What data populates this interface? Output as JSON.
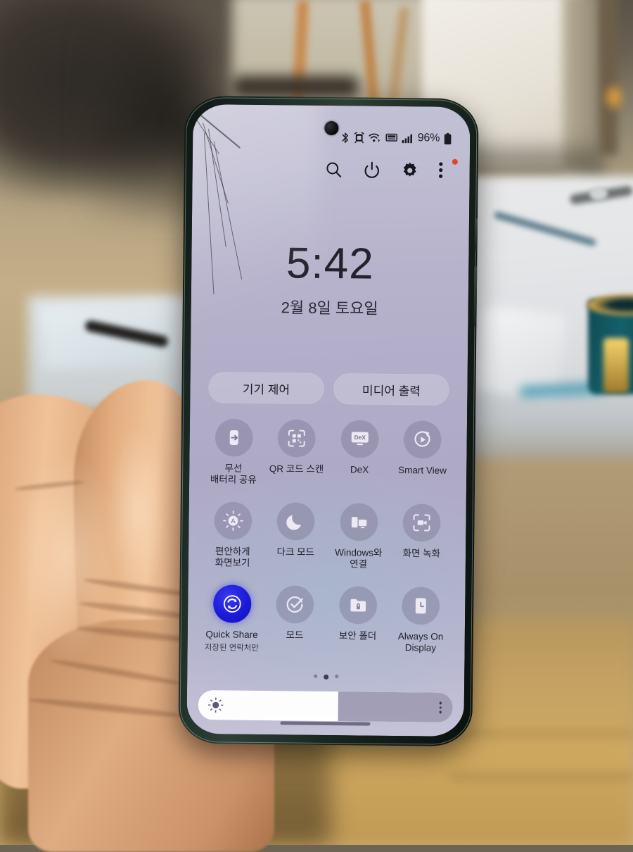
{
  "device": {
    "type": "smartphone",
    "orientation": "portrait",
    "screen_panel": "quick-settings",
    "note_visible_damage": "cracked glass top-left corner"
  },
  "colors": {
    "panel_bg": "#b2aec9",
    "accent_active": "#1a1ad8",
    "badge_red": "#e8402a",
    "text_primary": "#201f2a",
    "slider_track": "#8b86a4"
  },
  "statusbar": {
    "icons": [
      {
        "name": "bluetooth-icon",
        "label": "Bluetooth"
      },
      {
        "name": "alarm-icon",
        "label": "Alarm"
      },
      {
        "name": "wifi-calling-icon",
        "label": "Wi-Fi calling"
      },
      {
        "name": "volte-icon",
        "label": "VoLTE"
      },
      {
        "name": "signal-icon",
        "label": "Mobile signal"
      }
    ],
    "battery_percent": "96%",
    "battery_icon": "battery-full-icon"
  },
  "quick_settings_header": {
    "buttons": [
      {
        "name": "search-icon",
        "label": "Search"
      },
      {
        "name": "power-icon",
        "label": "Power"
      },
      {
        "name": "settings-gear-icon",
        "label": "Settings"
      },
      {
        "name": "overflow-menu-icon",
        "label": "More options",
        "badge": true
      }
    ]
  },
  "clock": {
    "time": "5:42",
    "date": "2월 8일 토요일"
  },
  "pills": [
    {
      "name": "device-control-pill",
      "label": "기기 제어"
    },
    {
      "name": "media-output-pill",
      "label": "미디어 출력"
    }
  ],
  "tiles": {
    "rows": [
      [
        {
          "name": "tile-wireless-power-share",
          "label": "무선\n배터리 공유",
          "icon": "battery-share-icon",
          "active": false
        },
        {
          "name": "tile-qr-scanner",
          "label": "QR 코드 스캔",
          "icon": "qr-scan-icon",
          "active": false
        },
        {
          "name": "tile-dex",
          "label": "DeX",
          "icon": "dex-icon",
          "active": false
        },
        {
          "name": "tile-smart-view",
          "label": "Smart View",
          "icon": "smart-view-icon",
          "active": false
        }
      ],
      [
        {
          "name": "tile-eye-comfort-shield",
          "label": "편안하게\n화면보기",
          "icon": "eye-comfort-icon",
          "active": false
        },
        {
          "name": "tile-dark-mode",
          "label": "다크 모드",
          "icon": "moon-icon",
          "active": false
        },
        {
          "name": "tile-link-to-windows",
          "label": "Windows와\n연결",
          "icon": "link-to-windows-icon",
          "active": false
        },
        {
          "name": "tile-screen-recorder",
          "label": "화면 녹화",
          "icon": "screen-record-icon",
          "active": false
        }
      ],
      [
        {
          "name": "tile-quick-share",
          "label": "Quick Share",
          "sublabel": "저장된 연락처만",
          "icon": "quick-share-icon",
          "active": true
        },
        {
          "name": "tile-modes",
          "label": "모드",
          "icon": "modes-icon",
          "active": false
        },
        {
          "name": "tile-secure-folder",
          "label": "보안 폴더",
          "icon": "secure-folder-icon",
          "active": false
        },
        {
          "name": "tile-always-on-display",
          "label": "Always On\nDisplay",
          "icon": "aod-icon",
          "active": false
        }
      ]
    ]
  },
  "page_indicator": {
    "total": 3,
    "active_index": 1
  },
  "brightness": {
    "name": "brightness-slider",
    "icon": "brightness-sun-icon",
    "value_percent": 55,
    "more_button": "brightness-options-icon"
  },
  "navigation": {
    "gesture_bar": "home-gesture-bar"
  }
}
